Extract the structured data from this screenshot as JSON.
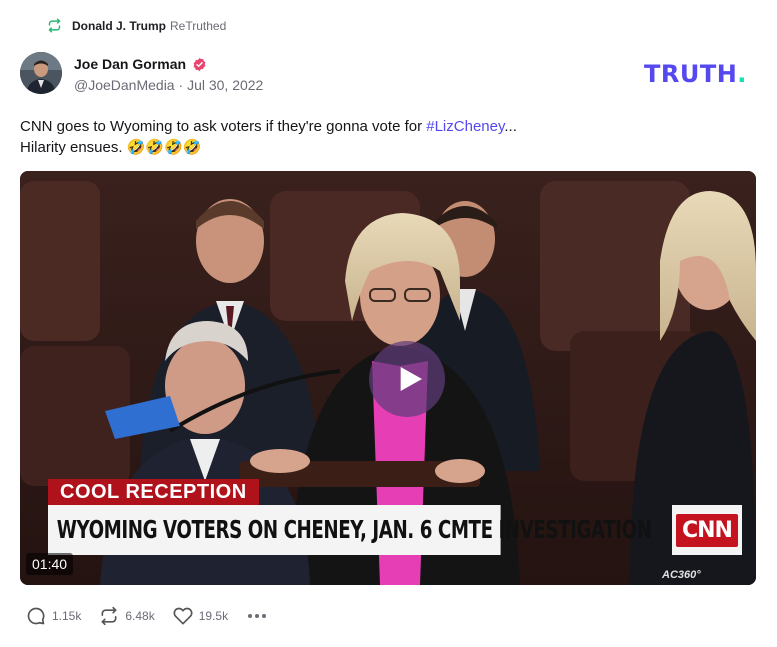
{
  "retruth": {
    "icon": "retruth-icon",
    "user": "Donald J. Trump",
    "verb": "ReTruthed"
  },
  "author": {
    "name": "Joe Dan Gorman",
    "verified_icon": "verified-badge-icon",
    "handle": "@JoeDanMedia",
    "separator": "·",
    "date": "Jul 30, 2022"
  },
  "brand": {
    "text": "TRUTH",
    "dot": "."
  },
  "post": {
    "line1_prefix": "CNN goes to Wyoming to ask voters if they're gonna vote for ",
    "hashtag": "#LizCheney",
    "line1_suffix": "...",
    "line2": "Hilarity ensues. 🤣🤣🤣🤣"
  },
  "video": {
    "lower_third_tag": "COOL RECEPTION",
    "lower_third_headline": "WYOMING VOTERS ON CHENEY, JAN. 6 CMTE INVESTIGATION",
    "network_logo": "CNN",
    "show_bug": "AC360°",
    "duration": "01:40",
    "play_icon": "play-icon"
  },
  "actions": {
    "replies": "1.15k",
    "retruths": "6.48k",
    "likes": "19.5k"
  },
  "colors": {
    "brand_purple": "#5448ee",
    "brand_teal": "#17e0b8",
    "verified_pink": "#e8456f",
    "retruth_green": "#2bb673",
    "cnn_red": "#c4131e"
  }
}
